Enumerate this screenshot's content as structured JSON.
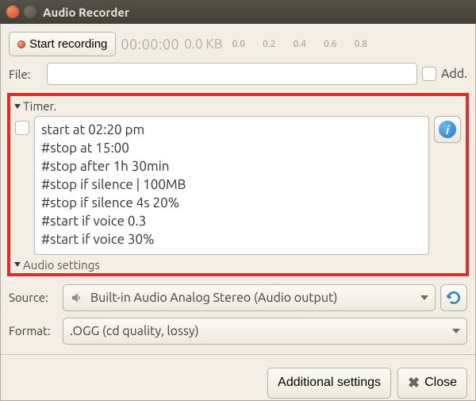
{
  "window_title": "Audio Recorder",
  "toolbar": {
    "start_label": "Start recording",
    "elapsed": "00:00:00",
    "size": "0.0 KB",
    "ticks": [
      "0.0",
      "0.2",
      "0.4",
      "0.6",
      "0.8"
    ]
  },
  "file": {
    "label": "File:",
    "value": "",
    "add_label": "Add."
  },
  "timer": {
    "header": "Timer.",
    "lines": [
      "start at 02:20 pm",
      "#stop at 15:00",
      "#stop after 1h 30min",
      "#stop if silence | 100MB",
      "#stop if silence 4s 20%",
      "#start if voice 0.3",
      "#start if voice 30%"
    ]
  },
  "audio_settings_header": "Audio settings",
  "source": {
    "label": "Source:",
    "selected": "Built-in Audio Analog Stereo (Audio output)"
  },
  "format": {
    "label": "Format:",
    "selected": ".OGG  (cd quality, lossy)"
  },
  "footer": {
    "additional": "Additional settings",
    "close": "Close"
  }
}
